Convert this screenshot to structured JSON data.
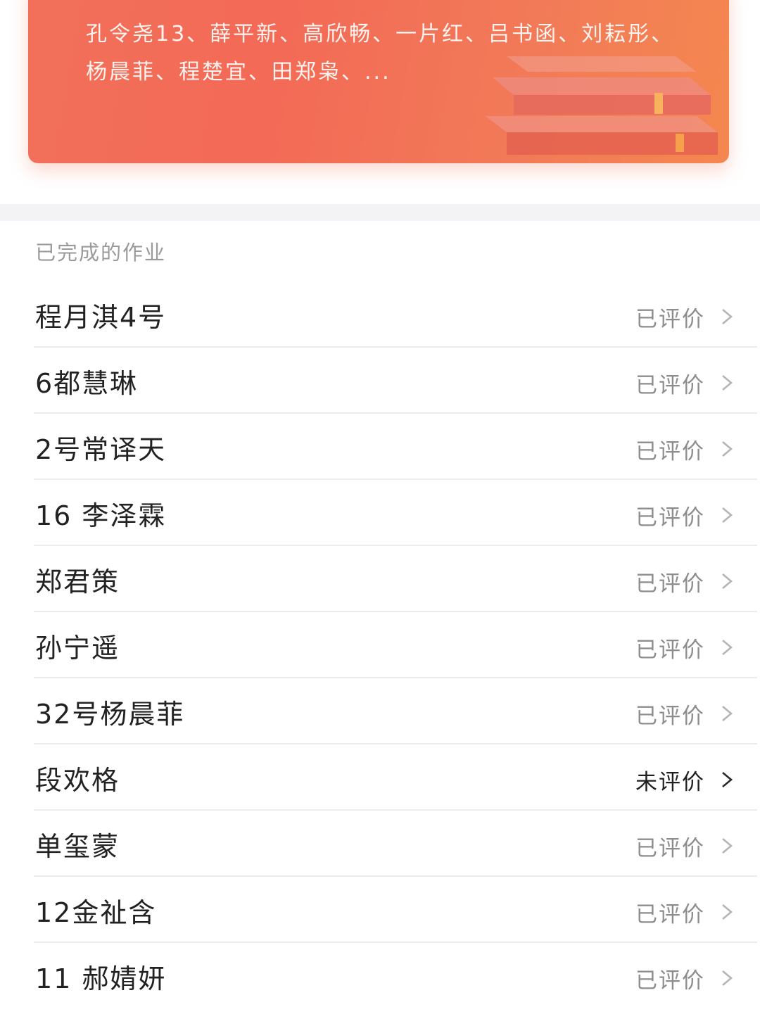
{
  "banner": {
    "names_text": "孔令尧13、薛平新、高欣畅、一片红、吕书函、刘耘彤、杨晨菲、程楚宜、田郑枭、..."
  },
  "section": {
    "title": "已完成的作业"
  },
  "rows": [
    {
      "name": "程月淇4号",
      "status": "已评价"
    },
    {
      "name": "6都慧琳",
      "status": "已评价"
    },
    {
      "name": "2号常译天",
      "status": "已评价"
    },
    {
      "name": "16 李泽霖",
      "status": "已评价"
    },
    {
      "name": "郑君策",
      "status": "已评价"
    },
    {
      "name": "孙宁遥",
      "status": "已评价"
    },
    {
      "name": "32号杨晨菲",
      "status": "已评价"
    },
    {
      "name": "段欢格",
      "status": "未评价"
    },
    {
      "name": "单玺蒙",
      "status": "已评价"
    },
    {
      "name": "12金祉含",
      "status": "已评价"
    },
    {
      "name": "11 郝婧妍",
      "status": "已评价"
    }
  ],
  "colors": {
    "banner_accent": "#f2705a",
    "status_done": "#8d8d8d",
    "status_pending": "#1f1f1f"
  },
  "icons": {
    "row_arrow": "chevron-right-icon",
    "banner_art": "book-stack-illustration"
  }
}
